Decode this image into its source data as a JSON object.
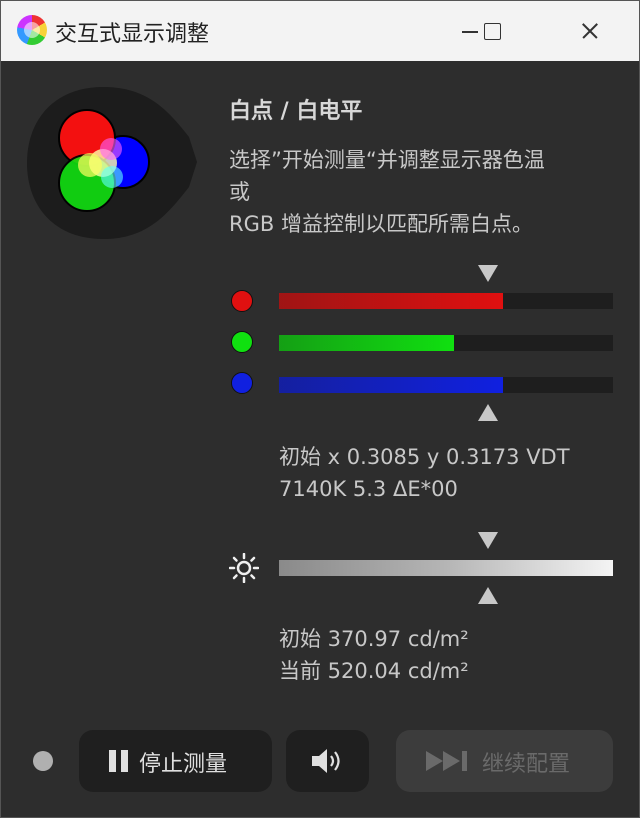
{
  "window": {
    "title": "交互式显示调整"
  },
  "section": {
    "heading": "白点 / 白电平",
    "description_lines": [
      "选择”开始测量“并调整显示器色温",
      "或",
      "RGB 增益控制以匹配所需白点。"
    ]
  },
  "rgb_bars": [
    {
      "channel": "red",
      "color": "#e01010",
      "level": 0.67
    },
    {
      "channel": "green",
      "color": "#10e010",
      "level": 0.525
    },
    {
      "channel": "blue",
      "color": "#1020e0",
      "level": 0.67
    }
  ],
  "white_point_target": 0.625,
  "white_point_readout": {
    "line1": "初始 x 0.3085 y 0.3173 VDT",
    "line2": "7140K 5.3 ΔE*00"
  },
  "luminance_target": 0.625,
  "luminance_readout": {
    "initial": "初始 370.97 cd/m²",
    "current": "当前 520.04 cd/m²"
  },
  "buttons": {
    "stop_label": "停止测量",
    "continue_label": "继续配置"
  },
  "icons": [
    "app-icon",
    "pause-icon",
    "speaker-icon",
    "skip-forward-icon",
    "brightness-icon"
  ]
}
